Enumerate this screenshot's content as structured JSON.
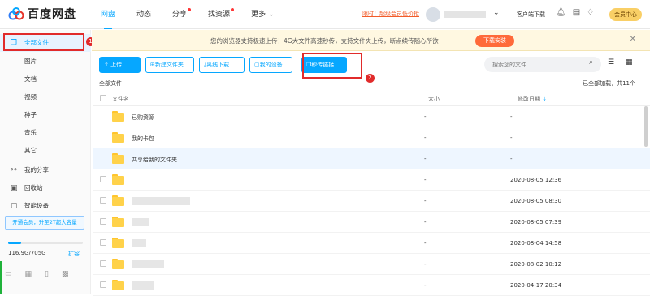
{
  "header": {
    "logo_text": "百度网盘",
    "nav": [
      {
        "label": "网盘"
      },
      {
        "label": "动态"
      },
      {
        "label": "分享"
      },
      {
        "label": "找资源"
      },
      {
        "label": "更多"
      }
    ],
    "promo": "限时！超级会员低价抢",
    "client": "客户端下载",
    "vip_button": "会员中心"
  },
  "sidebar": {
    "items": [
      {
        "label": "全部文件",
        "icon": "files-icon"
      },
      {
        "label": "图片"
      },
      {
        "label": "文档"
      },
      {
        "label": "视频"
      },
      {
        "label": "种子"
      },
      {
        "label": "音乐"
      },
      {
        "label": "其它"
      },
      {
        "label": "我的分享",
        "icon": "share-icon"
      },
      {
        "label": "回收站",
        "icon": "trash-icon"
      },
      {
        "label": "智能设备",
        "icon": "device-icon"
      }
    ],
    "vip_promo": "开通会员，升至2T超大容量",
    "quota_text": "116.9G/705G",
    "quota_fraction": 0.17,
    "expand": "扩容"
  },
  "annotations": {
    "badge1": "1",
    "badge2": "2"
  },
  "notice": {
    "text": "您的浏览器支持极速上传！4G大文件高速秒传，支持文件夹上传，断点续传随心所欲！",
    "button": "下载安装"
  },
  "toolbar": {
    "upload": "上传",
    "new_folder": "新建文件夹",
    "offline": "离线下载",
    "my_device": "我的设备",
    "instant_link": "秒传链接"
  },
  "search": {
    "placeholder": "搜索您的文件"
  },
  "breadcrumb": "全部文件",
  "loaded_text": "已全部加载，共11个",
  "table": {
    "headers": {
      "name": "文件名",
      "size": "大小",
      "date": "修改日期"
    },
    "rows": [
      {
        "name": "已购资源",
        "size": "-",
        "date": "-"
      },
      {
        "name": "我的卡包",
        "size": "-",
        "date": "-"
      },
      {
        "name": "共享给我的文件夹",
        "size": "-",
        "date": "-"
      },
      {
        "name": "",
        "size": "-",
        "date": "2020-08-05 12:36"
      },
      {
        "name": "",
        "size": "-",
        "date": "2020-08-05 08:30"
      },
      {
        "name": "",
        "size": "-",
        "date": "2020-08-05 07:39"
      },
      {
        "name": "",
        "size": "-",
        "date": "2020-08-04 14:58"
      },
      {
        "name": "",
        "size": "-",
        "date": "2020-08-02 10:12"
      },
      {
        "name": "",
        "size": "-",
        "date": "2020-04-17 20:34"
      }
    ]
  },
  "colors": {
    "accent": "#06a7ff",
    "annotation": "#e12b2b",
    "folder": "#ffd24a"
  }
}
